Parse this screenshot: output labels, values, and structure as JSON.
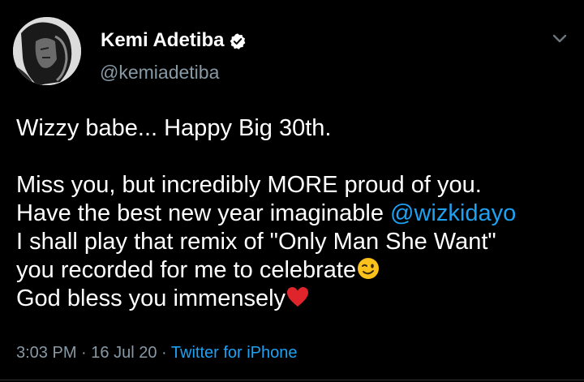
{
  "author": {
    "name": "Kemi Adetiba",
    "handle": "@kemiadetiba",
    "verified": true,
    "avatar_icon": "avatar-photo"
  },
  "tweet": {
    "lines": [
      "Wizzy babe... Happy Big 30th.",
      "Miss you, but incredibly MORE proud of you.",
      "Have the best new year imaginable ",
      "@wizkidayo",
      "I shall play that remix of \"Only Man She Want\"",
      "you recorded for me to celebrate",
      "God bless you immensely"
    ],
    "emojis": [
      "winking-face",
      "red-heart"
    ]
  },
  "meta": {
    "time": "3:03 PM",
    "separator": "·",
    "date": "16 Jul 20",
    "source": "Twitter for iPhone"
  },
  "colors": {
    "background": "#000000",
    "text": "#ffffff",
    "secondary": "#8899a6",
    "accent": "#1da1f2"
  },
  "icons": [
    "verified-badge-icon",
    "chevron-down-icon"
  ]
}
